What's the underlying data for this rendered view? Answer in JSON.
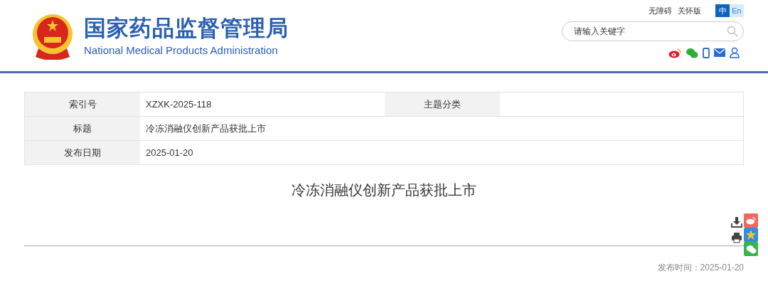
{
  "header": {
    "title": "国家药品监督管理局",
    "subtitle": "National Medical Products Administration",
    "links": [
      "无障碍",
      "关怀版"
    ],
    "languages": [
      {
        "label": "中",
        "selected": true
      },
      {
        "label": "En",
        "selected": false
      }
    ],
    "search": {
      "placeholder": "请输入关键字"
    }
  },
  "info_table": {
    "rows": [
      {
        "cells": [
          {
            "label": "索引号",
            "value": "XZXK-2025-118"
          },
          {
            "label": "主题分类"
          }
        ]
      },
      {
        "cells": [
          {
            "label": "标题",
            "value": "冷冻消融仪创新产品获批上市"
          }
        ]
      },
      {
        "cells": [
          {
            "label": "发布日期",
            "value": "2025-01-20"
          }
        ]
      }
    ]
  },
  "article": {
    "title": "冷冻消融仪创新产品获批上市",
    "published": "发布时间：2025-01-20"
  }
}
